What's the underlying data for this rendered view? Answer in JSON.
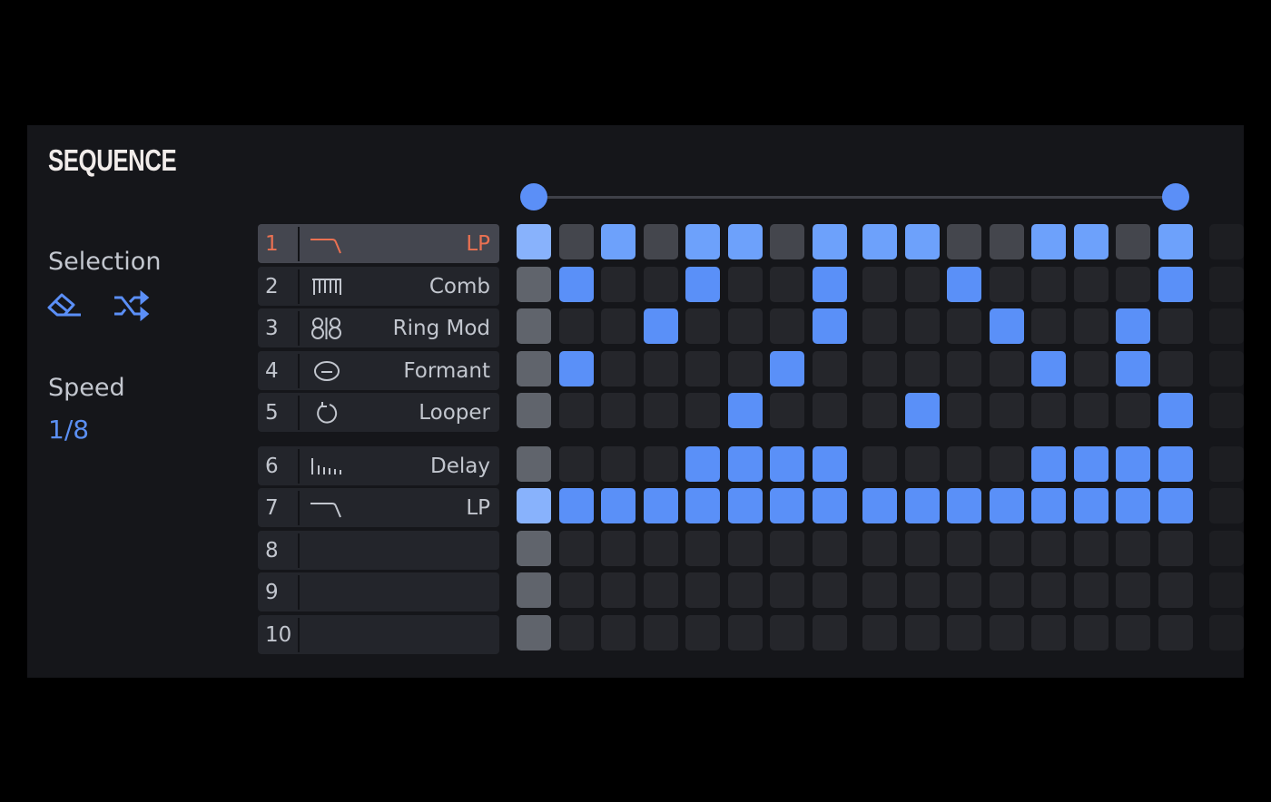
{
  "panel": {
    "title": "SEQUENCE",
    "selection_label": "Selection",
    "selection_actions": [
      {
        "name": "eraser-icon",
        "label": "Clear selection"
      },
      {
        "name": "shuffle-icon",
        "label": "Randomize selection"
      }
    ],
    "speed_label": "Speed",
    "speed_value": "1/8"
  },
  "colors": {
    "accent": "#5b8ff7",
    "active_step": "#5a90f8",
    "selected_track_text": "#ea7152",
    "panel_bg": "#15161a"
  },
  "range_slider": {
    "start_step": 1,
    "end_step": 16,
    "total_steps": 16
  },
  "tracks": [
    {
      "number": "1",
      "icon": "lowpass-icon",
      "name": "LP",
      "selected": true
    },
    {
      "number": "2",
      "icon": "comb-icon",
      "name": "Comb",
      "selected": false
    },
    {
      "number": "3",
      "icon": "ring-mod-icon",
      "name": "Ring Mod",
      "selected": false
    },
    {
      "number": "4",
      "icon": "formant-icon",
      "name": "Formant",
      "selected": false
    },
    {
      "number": "5",
      "icon": "looper-icon",
      "name": "Looper",
      "selected": false
    },
    {
      "number": "6",
      "icon": "delay-icon",
      "name": "Delay",
      "selected": false
    },
    {
      "number": "7",
      "icon": "lowpass-icon",
      "name": "LP",
      "selected": false
    },
    {
      "number": "8",
      "icon": "",
      "name": "",
      "selected": false
    },
    {
      "number": "9",
      "icon": "",
      "name": "",
      "selected": false
    },
    {
      "number": "10",
      "icon": "",
      "name": "",
      "selected": false
    }
  ],
  "steps": [
    [
      1,
      0,
      1,
      0,
      1,
      1,
      0,
      1,
      1,
      1,
      0,
      0,
      1,
      1,
      0,
      1
    ],
    [
      0,
      1,
      0,
      0,
      1,
      0,
      0,
      1,
      0,
      0,
      1,
      0,
      0,
      0,
      0,
      1
    ],
    [
      0,
      0,
      0,
      1,
      0,
      0,
      0,
      1,
      0,
      0,
      0,
      1,
      0,
      0,
      1,
      0
    ],
    [
      0,
      1,
      0,
      0,
      0,
      0,
      1,
      0,
      0,
      0,
      0,
      0,
      1,
      0,
      1,
      0
    ],
    [
      0,
      0,
      0,
      0,
      0,
      1,
      0,
      0,
      0,
      1,
      0,
      0,
      0,
      0,
      0,
      1
    ],
    [
      0,
      0,
      0,
      0,
      1,
      1,
      1,
      1,
      0,
      0,
      0,
      0,
      1,
      1,
      1,
      1
    ],
    [
      1,
      1,
      1,
      1,
      1,
      1,
      1,
      1,
      1,
      1,
      1,
      1,
      1,
      1,
      1,
      1
    ],
    [
      0,
      0,
      0,
      0,
      0,
      0,
      0,
      0,
      0,
      0,
      0,
      0,
      0,
      0,
      0,
      0
    ],
    [
      0,
      0,
      0,
      0,
      0,
      0,
      0,
      0,
      0,
      0,
      0,
      0,
      0,
      0,
      0,
      0
    ],
    [
      0,
      0,
      0,
      0,
      0,
      0,
      0,
      0,
      0,
      0,
      0,
      0,
      0,
      0,
      0,
      0
    ]
  ]
}
